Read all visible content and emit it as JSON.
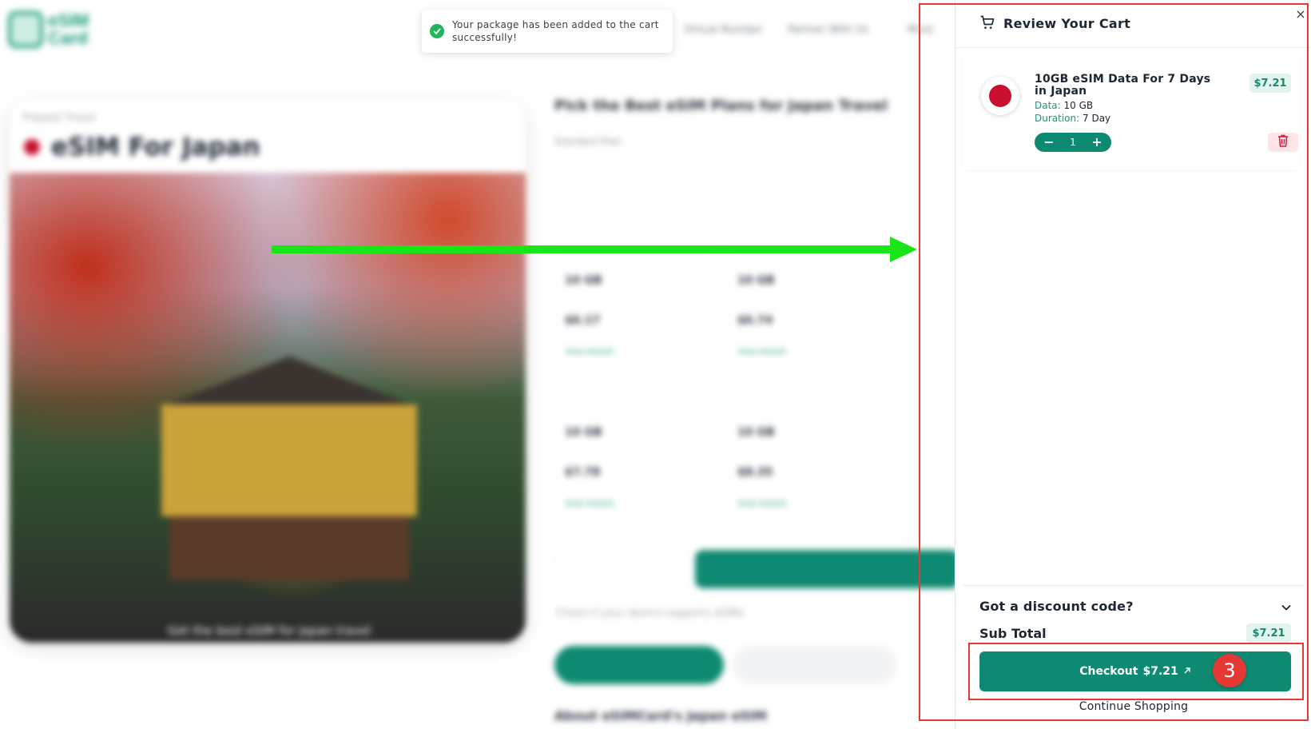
{
  "toast": {
    "message": "Your package has been added to the cart successfully!",
    "icon": "check-circle-icon"
  },
  "cart": {
    "title": "Review Your Cart",
    "close_icon": "close-icon",
    "item": {
      "title": "10GB eSIM Data For 7 Days in Japan",
      "data_key": "Data:",
      "data_value": "10 GB",
      "duration_key": "Duration:",
      "duration_value": "7 Day",
      "price": "$7.21",
      "quantity": "1",
      "minus_label": "−",
      "plus_label": "+"
    },
    "discount_label": "Got a discount code?",
    "subtotal_label": "Sub Total",
    "subtotal_value": "$7.21",
    "checkout_label": "Checkout",
    "checkout_amount": "$7.21",
    "continue_label": "Continue Shopping"
  },
  "annotation": {
    "step_number": "3"
  },
  "colors": {
    "brand_green": "#0f8a72",
    "price_pill_bg": "#e3f4ef",
    "annotation_red": "#e53935",
    "arrow_green": "#19e619"
  }
}
